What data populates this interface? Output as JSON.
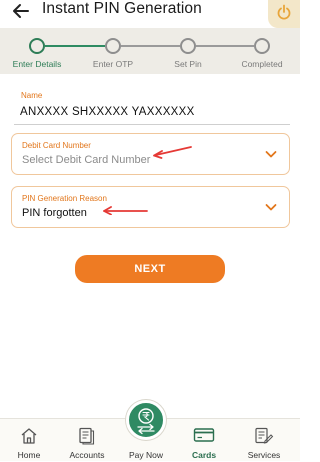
{
  "header": {
    "title": "Instant PIN Generation",
    "back_icon": "arrow-left-icon",
    "power_icon": "power-icon",
    "accent": "#e2761b"
  },
  "stepper": {
    "steps": [
      {
        "label": "Enter Details",
        "active": true
      },
      {
        "label": "Enter OTP",
        "active": false
      },
      {
        "label": "Set Pin",
        "active": false
      },
      {
        "label": "Completed",
        "active": false
      }
    ],
    "active_color": "#2e7d57"
  },
  "form": {
    "name": {
      "label": "Name",
      "value": "ANXXXX SHXXXXX YAXXXXXX"
    },
    "debit_card": {
      "label": "Debit Card Number",
      "placeholder": "Select Debit Card Number"
    },
    "reason": {
      "label": "PIN Generation Reason",
      "value": "PIN forgotten"
    },
    "next_label": "NEXT",
    "button_color": "#ee7b23"
  },
  "bottom_nav": {
    "items": [
      {
        "label": "Home",
        "icon": "home-icon",
        "active": false
      },
      {
        "label": "Accounts",
        "icon": "document-icon",
        "active": false
      },
      {
        "label": "Pay Now",
        "icon": "rupee-exchange-icon",
        "active": false
      },
      {
        "label": "Cards",
        "icon": "card-icon",
        "active": true
      },
      {
        "label": "Services",
        "icon": "services-icon",
        "active": false
      }
    ]
  }
}
